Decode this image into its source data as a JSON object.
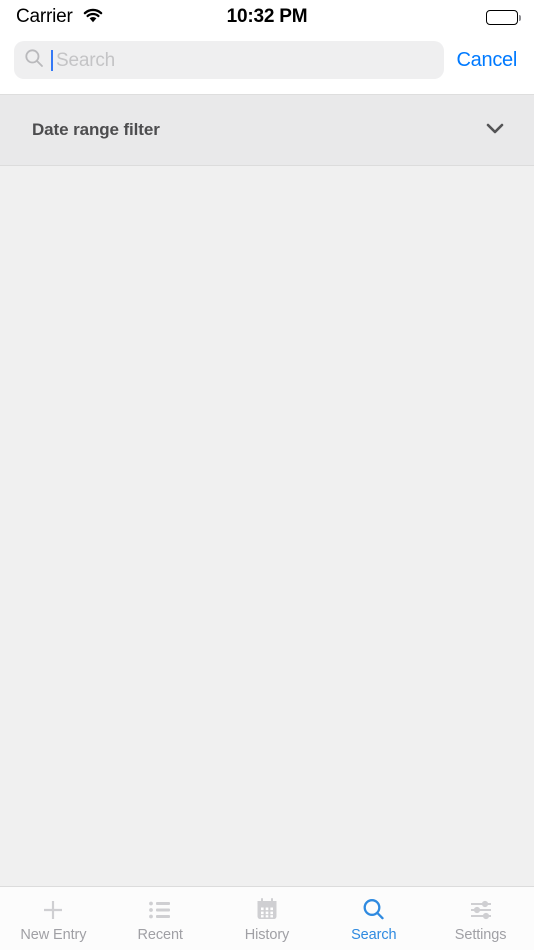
{
  "status_bar": {
    "carrier": "Carrier",
    "wifi_icon": "wifi-icon",
    "time": "10:32 PM",
    "battery_icon": "battery-full-icon"
  },
  "search_header": {
    "search_icon": "search-icon",
    "placeholder": "Search",
    "value": "",
    "cursor_visible": true,
    "cancel_label": "Cancel",
    "cancel_color": "#007aff"
  },
  "filter_bar": {
    "title": "Date range filter",
    "expanded": false,
    "chevron_icon": "chevron-down-icon",
    "background": "#e9e9ea"
  },
  "content": {
    "results": [],
    "background": "#f0f0f0"
  },
  "tab_bar": {
    "active_color": "#2f8ae0",
    "inactive_color": "#a0a0a5",
    "items": [
      {
        "label": "New Entry",
        "icon": "plus-icon",
        "active": false
      },
      {
        "label": "Recent",
        "icon": "list-icon",
        "active": false
      },
      {
        "label": "History",
        "icon": "calendar-icon",
        "active": false
      },
      {
        "label": "Search",
        "icon": "search-icon",
        "active": true
      },
      {
        "label": "Settings",
        "icon": "sliders-icon",
        "active": false
      }
    ]
  }
}
